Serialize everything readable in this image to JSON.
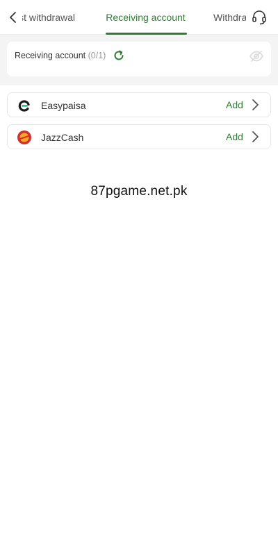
{
  "header": {
    "tabs": [
      {
        "label": "st withdrawal"
      },
      {
        "label": "Receiving account"
      },
      {
        "label": "Withdrawal F"
      }
    ]
  },
  "account_card": {
    "title": "Receiving account",
    "count": "(0/1)"
  },
  "payment_methods": [
    {
      "name": "Easypaisa",
      "action": "Add",
      "logo": "easypaisa-logo"
    },
    {
      "name": "JazzCash",
      "action": "Add",
      "logo": "jazzcash-logo"
    }
  ],
  "watermark": "87pgame.net.pk",
  "colors": {
    "accent": "#2e7d32",
    "background": "#f4f4f4"
  }
}
